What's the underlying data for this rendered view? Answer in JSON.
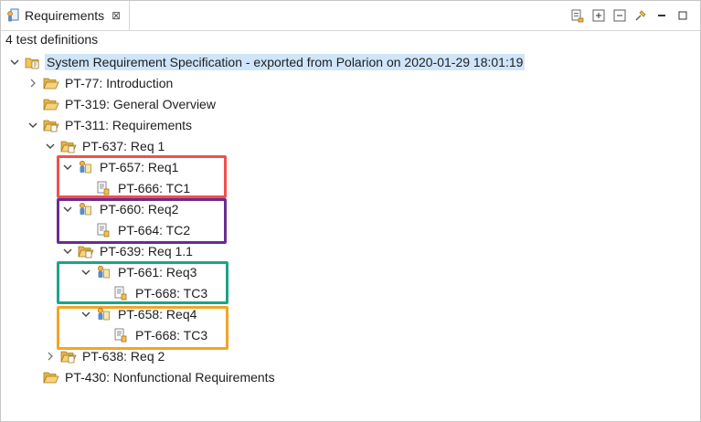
{
  "tab": {
    "title": "Requirements",
    "close": "⊠"
  },
  "toolbar": {
    "icons": [
      "export-icon",
      "expand-all-icon",
      "collapse-all-icon",
      "pin-icon",
      "maximize-icon"
    ]
  },
  "status": "4 test definitions",
  "tree": {
    "root": "System Requirement Specification - exported from Polarion on 2020-01-29 18:01:19",
    "n1": "PT-77: Introduction",
    "n2": "PT-319: General Overview",
    "n3": "PT-311: Requirements",
    "n3a": "PT-637: Req 1",
    "n3a1": "PT-657: Req1",
    "n3a1a": "PT-666: TC1",
    "n3a2": "PT-660: Req2",
    "n3a2a": "PT-664: TC2",
    "n3a3": "PT-639: Req 1.1",
    "n3a3a": "PT-661: Req3",
    "n3a3a1": "PT-668: TC3",
    "n3a3b": "PT-658: Req4",
    "n3a3b1": "PT-668: TC3",
    "n3b": "PT-638: Req 2",
    "n4": "PT-430: Nonfunctional Requirements"
  },
  "highlights": {
    "red": "#f0504f",
    "purple": "#6a2c91",
    "teal": "#1aa58a",
    "orange": "#f4a525"
  }
}
